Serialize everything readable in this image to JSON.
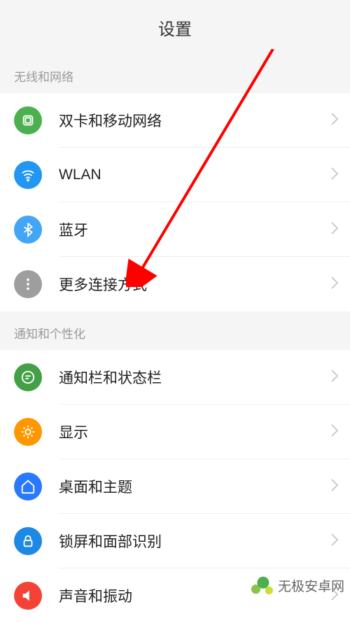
{
  "header": {
    "title": "设置"
  },
  "sections": [
    {
      "title": "无线和网络",
      "items": [
        {
          "label": "双卡和移动网络"
        },
        {
          "label": "WLAN"
        },
        {
          "label": "蓝牙"
        },
        {
          "label": "更多连接方式"
        }
      ]
    },
    {
      "title": "通知和个性化",
      "items": [
        {
          "label": "通知栏和状态栏"
        },
        {
          "label": "显示"
        },
        {
          "label": "桌面和主题"
        },
        {
          "label": "锁屏和面部识别"
        },
        {
          "label": "声音和振动"
        }
      ]
    }
  ],
  "watermark": {
    "text": "无极安卓网"
  }
}
